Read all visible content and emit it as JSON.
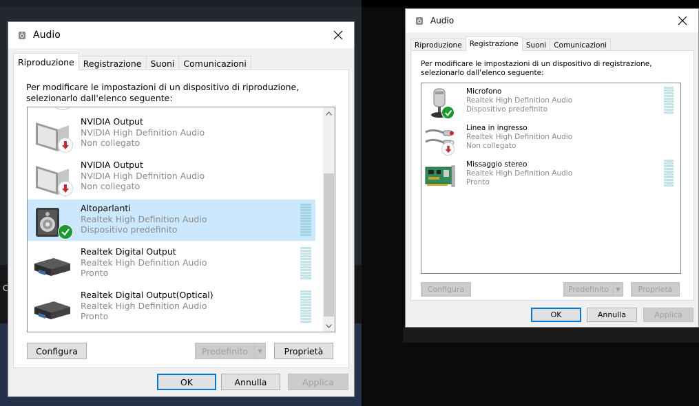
{
  "background": {
    "left_text": "C"
  },
  "dialogs": [
    {
      "title": "Audio",
      "tabs": [
        {
          "label": "Riproduzione",
          "active": true
        },
        {
          "label": "Registrazione",
          "active": false
        },
        {
          "label": "Suoni",
          "active": false
        },
        {
          "label": "Comunicazioni",
          "active": false
        }
      ],
      "description": "Per modificare le impostazioni di un dispositivo di riproduzione, selezionarlo dall'elenco seguente:",
      "devices": [
        {
          "name": "NVIDIA Output",
          "driver": "NVIDIA High Definition Audio",
          "status": "Non collegato",
          "icon": "monitor-icon",
          "badge": "disconnected",
          "meter": false,
          "selected": false
        },
        {
          "name": "NVIDIA Output",
          "driver": "NVIDIA High Definition Audio",
          "status": "Non collegato",
          "icon": "monitor-icon",
          "badge": "disconnected",
          "meter": false,
          "selected": false
        },
        {
          "name": "Altoparlanti",
          "driver": "Realtek High Definition Audio",
          "status": "Dispositivo predefinito",
          "icon": "speaker-icon",
          "badge": "default",
          "meter": true,
          "selected": true
        },
        {
          "name": "Realtek Digital Output",
          "driver": "Realtek High Definition Audio",
          "status": "Pronto",
          "icon": "digital-output-icon",
          "badge": "none",
          "meter": true,
          "selected": false
        },
        {
          "name": "Realtek Digital Output(Optical)",
          "driver": "Realtek High Definition Audio",
          "status": "Pronto",
          "icon": "digital-output-icon",
          "badge": "none",
          "meter": true,
          "selected": false
        }
      ],
      "buttons": {
        "configure": "Configura",
        "default": "Predefinito",
        "properties": "Proprietà",
        "ok": "OK",
        "cancel": "Annulla",
        "apply": "Applica"
      }
    },
    {
      "title": "Audio",
      "tabs": [
        {
          "label": "Riproduzione",
          "active": false
        },
        {
          "label": "Registrazione",
          "active": true
        },
        {
          "label": "Suoni",
          "active": false
        },
        {
          "label": "Comunicazioni",
          "active": false
        }
      ],
      "description": "Per modificare le impostazioni di un dispositivo di registrazione, selezionarlo dall'elenco seguente:",
      "devices": [
        {
          "name": "Microfono",
          "driver": "Realtek High Definition Audio",
          "status": "Dispositivo predefinito",
          "icon": "microphone-icon",
          "badge": "default",
          "meter": true
        },
        {
          "name": "Linea in ingresso",
          "driver": "Realtek High Definition Audio",
          "status": "Non collegato",
          "icon": "line-in-icon",
          "badge": "disconnected",
          "meter": false
        },
        {
          "name": "Missaggio stereo",
          "driver": "Realtek High Definition Audio",
          "status": "Pronto",
          "icon": "sound-card-icon",
          "badge": "none",
          "meter": true
        }
      ],
      "buttons": {
        "configure": "Configura",
        "default": "Predefinito",
        "properties": "Proprietà",
        "ok": "OK",
        "cancel": "Annulla",
        "apply": "Applica"
      }
    }
  ],
  "colors": {
    "selection": "#cce8ff",
    "accent": "#0078d7",
    "default_badge": "#1a9a2f",
    "disconnected_badge": "#d3242b"
  }
}
